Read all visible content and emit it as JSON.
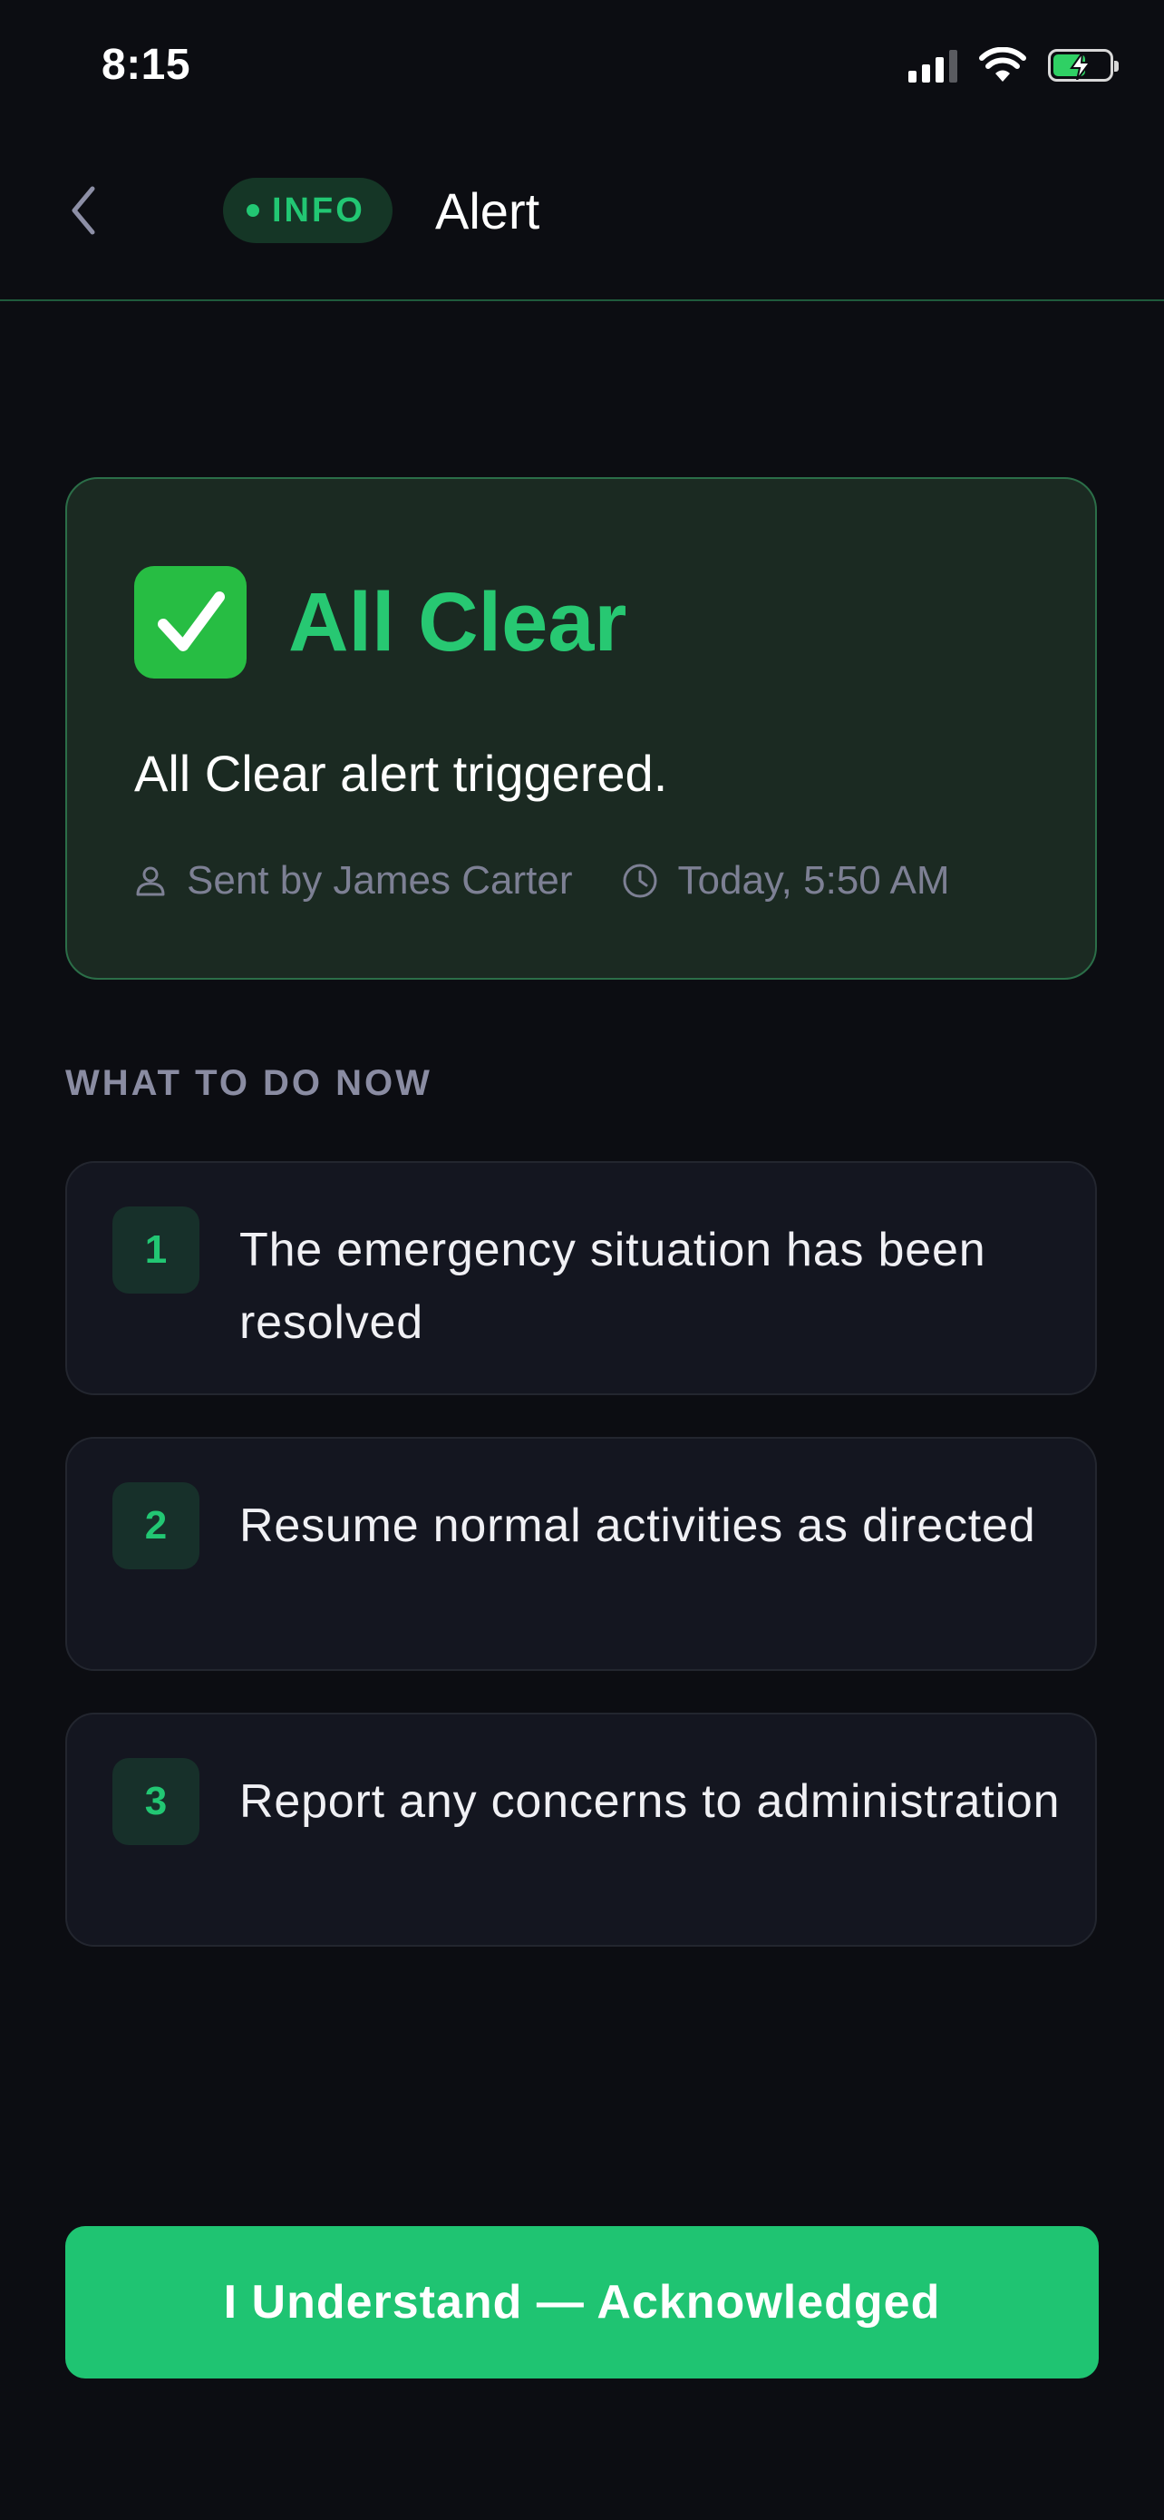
{
  "status_bar": {
    "time": "8:15",
    "icons": [
      "signal-icon",
      "wifi-icon",
      "battery-charging-icon"
    ]
  },
  "header": {
    "back_icon": "chevron-left-icon",
    "badge_label": "INFO",
    "title": "Alert"
  },
  "alert": {
    "emoji": "✅",
    "title": "All Clear",
    "message": "All Clear alert triggered.",
    "sent_by": "Sent by James Carter",
    "time": "Today, 5:50 AM",
    "accent_color": "#27c872"
  },
  "section": {
    "label": "WHAT TO DO NOW"
  },
  "steps": [
    {
      "number": "1",
      "text": "The emergency situation has been resolved"
    },
    {
      "number": "2",
      "text": "Resume normal activities as directed"
    },
    {
      "number": "3",
      "text": "Report any concerns to administration"
    }
  ],
  "action": {
    "acknowledge_label": "I Understand — Acknowledged",
    "color": "#1fc472"
  }
}
